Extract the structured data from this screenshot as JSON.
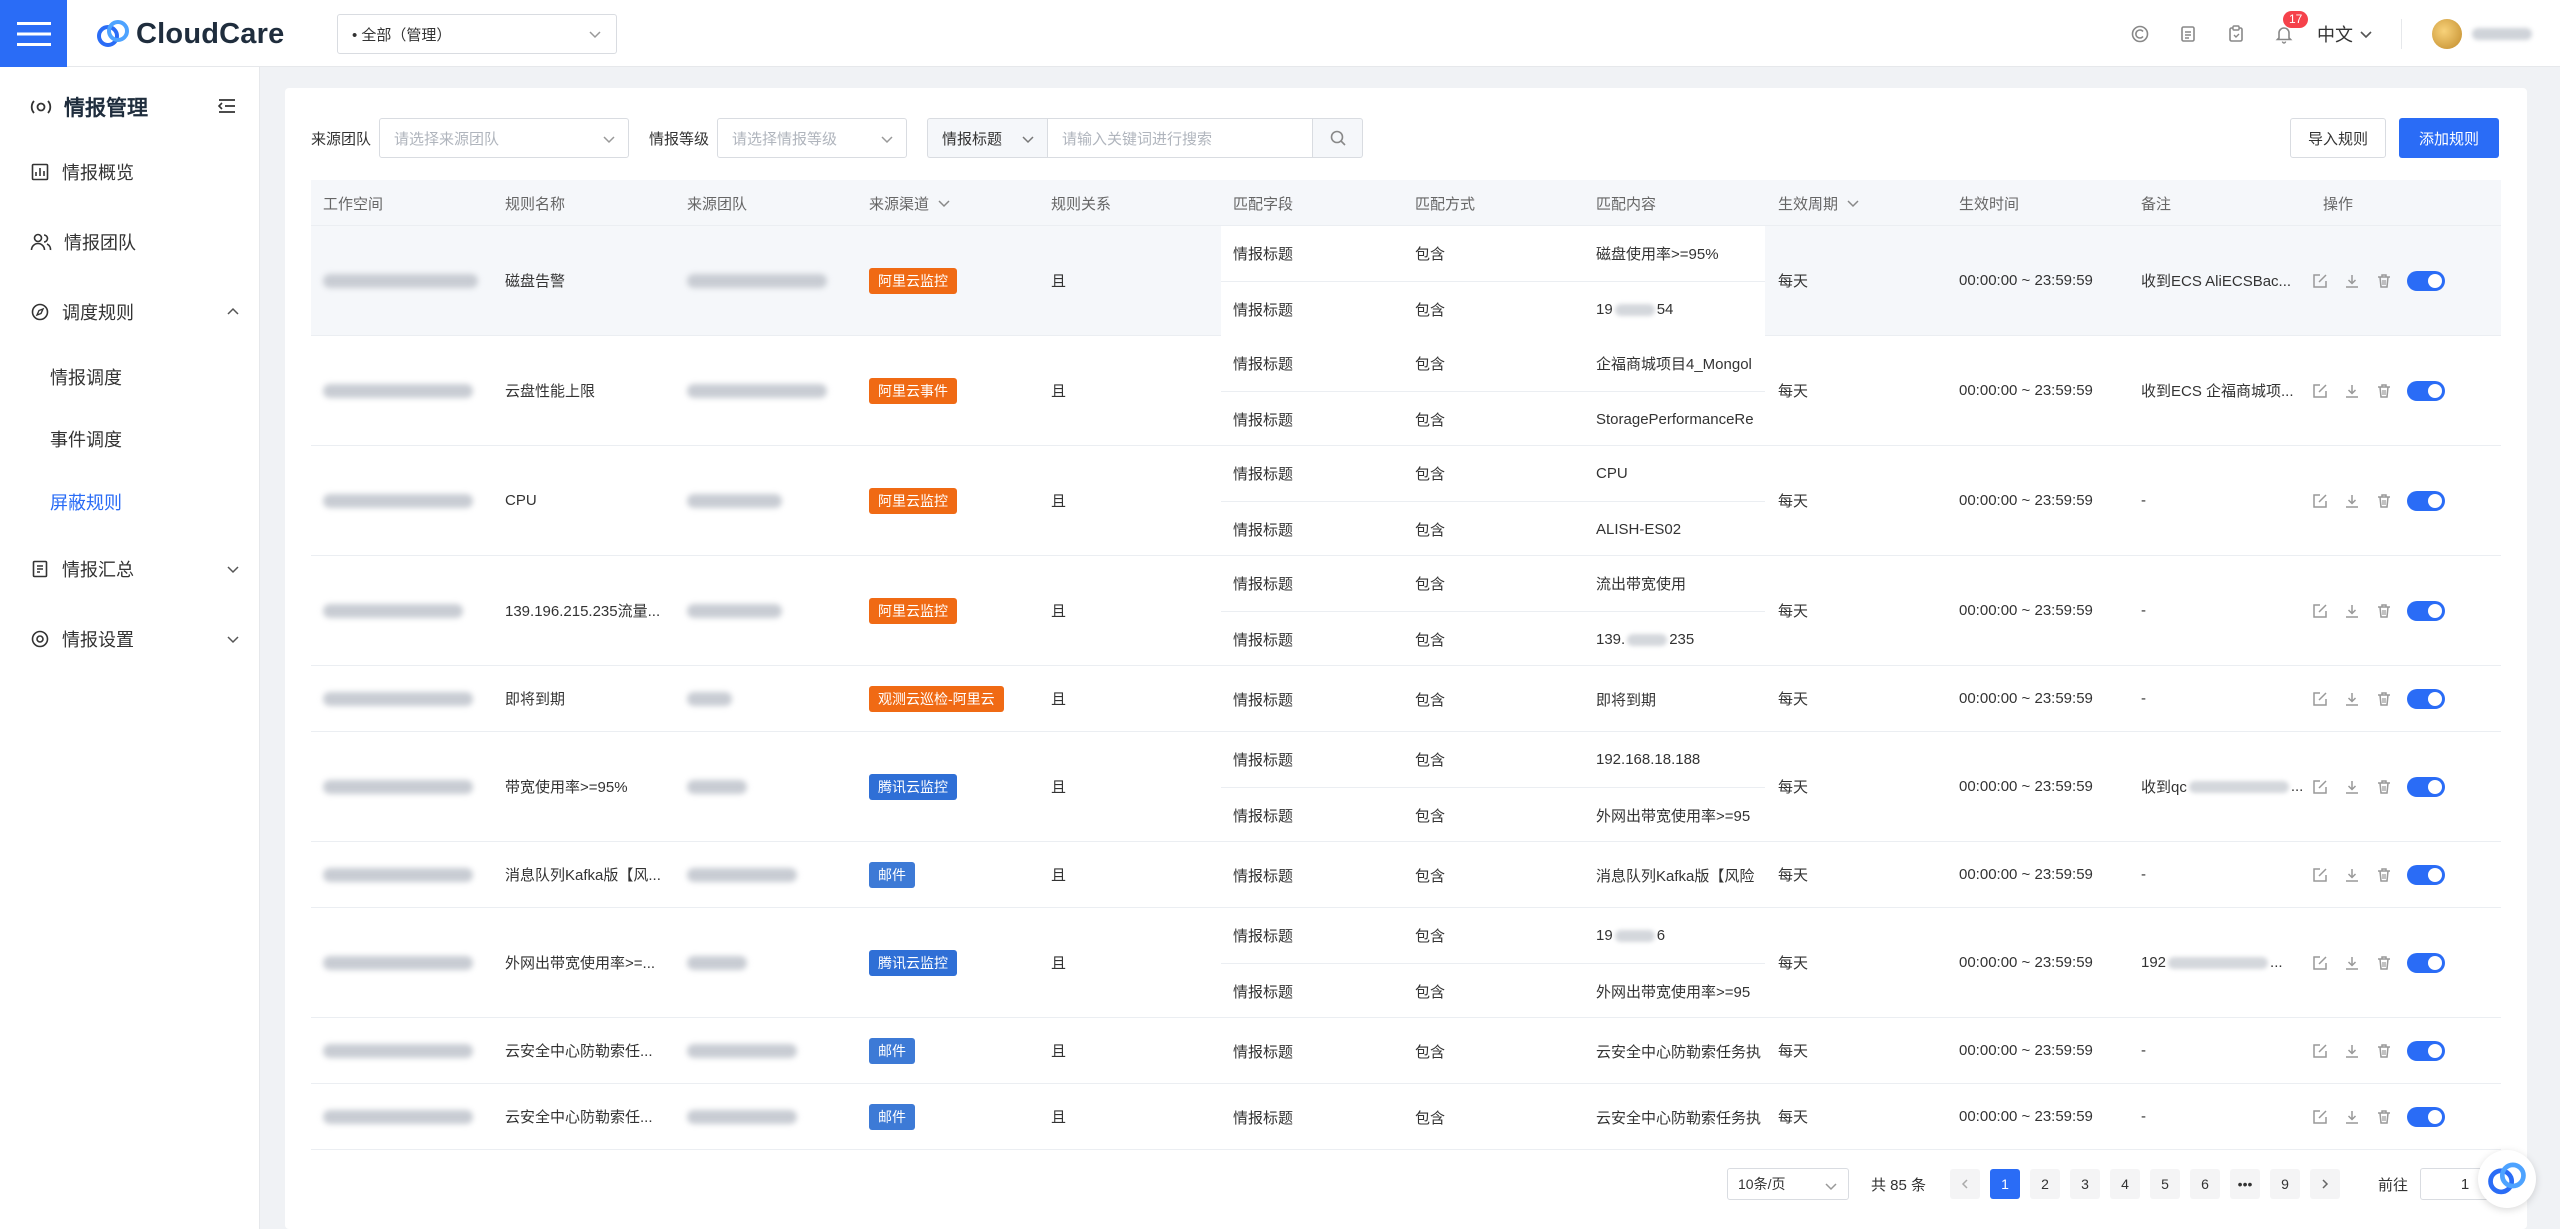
{
  "header": {
    "logo_text": "CloudCare",
    "workspace": "• 全部（管理）",
    "notification_count": "17",
    "language": "中文"
  },
  "sidebar": {
    "title": "情报管理",
    "items": [
      {
        "label": "情报概览"
      },
      {
        "label": "情报团队"
      },
      {
        "label": "调度规则"
      },
      {
        "label": "情报汇总"
      },
      {
        "label": "情报设置"
      }
    ],
    "sub_items": [
      {
        "label": "情报调度"
      },
      {
        "label": "事件调度"
      },
      {
        "label": "屏蔽规则"
      }
    ]
  },
  "filters": {
    "team_label": "来源团队",
    "team_placeholder": "请选择来源团队",
    "level_label": "情报等级",
    "level_placeholder": "请选择情报等级",
    "search_type": "情报标题",
    "search_placeholder": "请输入关键词进行搜索",
    "import_label": "导入规则",
    "add_label": "添加规则"
  },
  "table": {
    "columns": [
      "工作空间",
      "规则名称",
      "来源团队",
      "来源渠道",
      "规则关系",
      "匹配字段",
      "匹配方式",
      "匹配内容",
      "生效周期",
      "生效时间",
      "备注",
      "操作"
    ],
    "rows": [
      {
        "name": "磁盘告警",
        "channel": "阿里云监控",
        "relation": "且",
        "period": "每天",
        "time": "00:00:00 ~ 23:59:59",
        "remark": "收到ECS AliECSBac...",
        "matches": [
          {
            "field": "情报标题",
            "method": "包含",
            "content": "磁盘使用率>=95%"
          },
          {
            "field": "情报标题",
            "method": "包含",
            "content": "19",
            "content_tail": "54"
          }
        ]
      },
      {
        "name": "云盘性能上限",
        "channel": "阿里云事件",
        "relation": "且",
        "period": "每天",
        "time": "00:00:00 ~ 23:59:59",
        "remark": "收到ECS 企福商城项...",
        "matches": [
          {
            "field": "情报标题",
            "method": "包含",
            "content": "企福商城项目4_Mongol"
          },
          {
            "field": "情报标题",
            "method": "包含",
            "content": "StoragePerformanceRe"
          }
        ]
      },
      {
        "name": "CPU",
        "channel": "阿里云监控",
        "relation": "且",
        "period": "每天",
        "time": "00:00:00 ~ 23:59:59",
        "remark": "-",
        "matches": [
          {
            "field": "情报标题",
            "method": "包含",
            "content": "CPU"
          },
          {
            "field": "情报标题",
            "method": "包含",
            "content": "ALISH-ES02"
          }
        ]
      },
      {
        "name": "139.196.215.235流量...",
        "channel": "阿里云监控",
        "relation": "且",
        "period": "每天",
        "time": "00:00:00 ~ 23:59:59",
        "remark": "-",
        "matches": [
          {
            "field": "情报标题",
            "method": "包含",
            "content": "流出带宽使用"
          },
          {
            "field": "情报标题",
            "method": "包含",
            "content": "139.",
            "content_tail": "235"
          }
        ]
      },
      {
        "name": "即将到期",
        "channel": "观测云巡检-阿里云",
        "relation": "且",
        "period": "每天",
        "time": "00:00:00 ~ 23:59:59",
        "remark": "-",
        "matches": [
          {
            "field": "情报标题",
            "method": "包含",
            "content": "即将到期"
          }
        ]
      },
      {
        "name": "带宽使用率>=95%",
        "channel": "腾讯云监控",
        "relation": "且",
        "period": "每天",
        "time": "00:00:00 ~ 23:59:59",
        "remark": "收到qc",
        "matches": [
          {
            "field": "情报标题",
            "method": "包含",
            "content": "192.168.18.188"
          },
          {
            "field": "情报标题",
            "method": "包含",
            "content": "外网出带宽使用率>=95"
          }
        ]
      },
      {
        "name": "消息队列Kafka版【风...",
        "channel": "邮件",
        "relation": "且",
        "period": "每天",
        "time": "00:00:00 ~ 23:59:59",
        "remark": "-",
        "matches": [
          {
            "field": "情报标题",
            "method": "包含",
            "content": "消息队列Kafka版【风险"
          }
        ]
      },
      {
        "name": "外网出带宽使用率>=...",
        "channel": "腾讯云监控",
        "relation": "且",
        "period": "每天",
        "time": "00:00:00 ~ 23:59:59",
        "remark": "192",
        "matches": [
          {
            "field": "情报标题",
            "method": "包含",
            "content": "19",
            "content_tail": "6"
          },
          {
            "field": "情报标题",
            "method": "包含",
            "content": "外网出带宽使用率>=95"
          }
        ]
      },
      {
        "name": "云安全中心防勒索任...",
        "channel": "邮件",
        "relation": "且",
        "period": "每天",
        "time": "00:00:00 ~ 23:59:59",
        "remark": "-",
        "matches": [
          {
            "field": "情报标题",
            "method": "包含",
            "content": "云安全中心防勒索任务执"
          }
        ]
      },
      {
        "name": "云安全中心防勒索任...",
        "channel": "邮件",
        "relation": "且",
        "period": "每天",
        "time": "00:00:00 ~ 23:59:59",
        "remark": "-",
        "matches": [
          {
            "field": "情报标题",
            "method": "包含",
            "content": "云安全中心防勒索任务执"
          }
        ]
      }
    ]
  },
  "pagination": {
    "page_size": "10条/页",
    "total": "共 85 条",
    "pages": [
      "1",
      "2",
      "3",
      "4",
      "5",
      "6",
      "9"
    ],
    "ellipsis": "•••",
    "goto_label": "前往",
    "goto_value": "1"
  },
  "colors": {
    "primary": "#2a6cf6",
    "tag_orange": "#f06a14",
    "tag_blue": "#2f6fd6"
  }
}
